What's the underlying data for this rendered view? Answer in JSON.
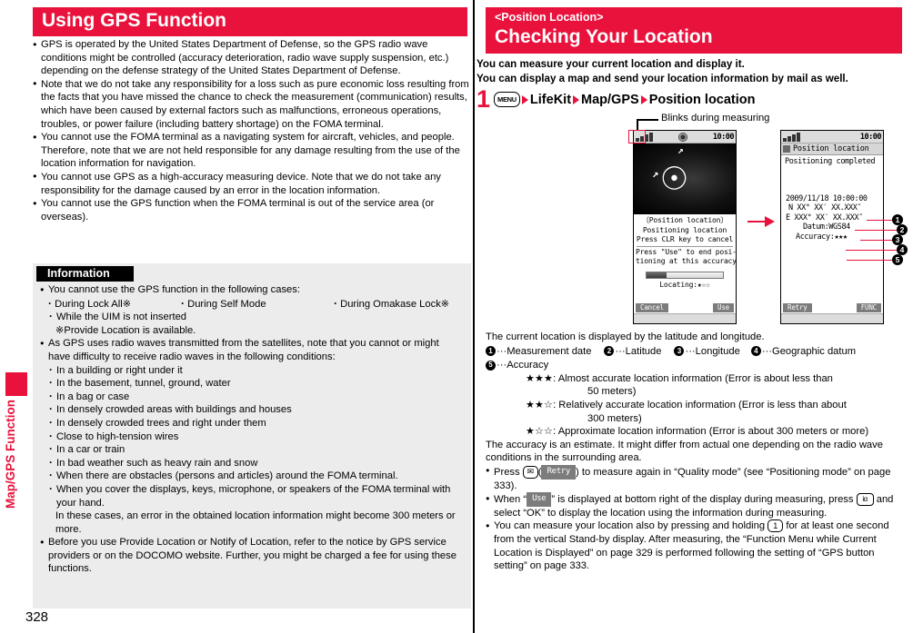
{
  "sidebar": {
    "vertical_label": "Map/GPS Function"
  },
  "page_number": "328",
  "left": {
    "title": "Using GPS Function",
    "bullets": [
      "GPS is operated by the United States Department of Defense, so the GPS radio wave conditions might be controlled (accuracy deterioration, radio wave supply suspension, etc.) depending on the defense strategy of the United States Department of Defense.",
      "Note that we do not take any responsibility for a loss such as pure economic loss resulting from the facts that you have missed the chance to check the measurement (communication) results, which have been caused by external factors such as malfunctions, erroneous operations, troubles, or power failure (including battery shortage) on the FOMA terminal.",
      "You cannot use the FOMA terminal as a navigating system for aircraft, vehicles, and people. Therefore, note that we are not held responsible for any damage resulting from the use of the location information for navigation.",
      "You cannot use GPS as a high-accuracy measuring device. Note that we do not take any responsibility for the damage caused by an error in the location information.",
      "You cannot use the GPS function when the FOMA terminal is out of the service area (or overseas)."
    ],
    "information": {
      "heading": "Information",
      "item1_lead": "You cannot use the GPS function in the following cases:",
      "item1_cases": [
        "During Lock All※",
        "During Self Mode",
        "During Omakase Lock※"
      ],
      "item1_case4": "While the UIM is not inserted",
      "item1_note": "※Provide Location is available.",
      "item2_lead": "As GPS uses radio waves transmitted from the satellites, note that you cannot or might have difficulty to receive radio waves in the following conditions:",
      "item2_conditions": [
        "In a building or right under it",
        "In the basement, tunnel, ground, water",
        "In a bag or case",
        "In densely crowded areas with buildings and houses",
        "In densely crowded trees and right under them",
        "Close to high-tension wires",
        "In a car or train",
        "In bad weather such as heavy rain and snow",
        "When there are obstacles (persons and articles) around the FOMA terminal.",
        "When you cover the displays, keys, microphone, or speakers of the FOMA terminal with your hand."
      ],
      "item2_tail": "In these cases, an error in the obtained location information might become 300 meters or more.",
      "item3": "Before you use Provide Location or Notify of Location, refer to the notice by GPS service providers or on the DOCOMO website. Further, you might be charged a fee for using these functions."
    }
  },
  "right": {
    "header_small": "<Position Location>",
    "header_big": "Checking Your Location",
    "lead_line1": "You can measure your current location and display it.",
    "lead_line2": "You can display a map and send your location information by mail as well.",
    "step": {
      "number": "1",
      "menu_key": "MENU",
      "path": [
        "LifeKit",
        "Map/GPS",
        "Position location"
      ]
    },
    "callout": "Blinks during measuring",
    "phone1": {
      "status_time": "10:00",
      "line1": "〔Position location〕",
      "line2": "Positioning location",
      "line3": "Press CLR key to cancel",
      "line4": "Press \"Use\" to end posi-",
      "line5": "tioning at this accuracy",
      "locating": "Locating:★☆☆",
      "softkey_left": "Cancel",
      "softkey_right": "Use"
    },
    "phone2": {
      "status_time": "10:00",
      "title": "Position location",
      "status_line": "Positioning completed",
      "fields": [
        "2009/11/18 10:00:00",
        "N XX° XX′ XX.XXX″",
        "E XXX° XX′ XX.XXX″",
        "Datum:WGS84",
        "Accuracy:★★★"
      ],
      "softkey_left": "Retry",
      "softkey_right": "FUNC"
    },
    "callout_numbers": [
      "1",
      "2",
      "3",
      "4",
      "5"
    ],
    "explain_intro": "The current location is displayed by the latitude and longitude.",
    "legend": [
      {
        "num": "1",
        "label": "Measurement date"
      },
      {
        "num": "2",
        "label": "Latitude"
      },
      {
        "num": "3",
        "label": "Longitude"
      },
      {
        "num": "4",
        "label": "Geographic datum"
      },
      {
        "num": "5",
        "label": "Accuracy"
      }
    ],
    "accuracy_levels": [
      {
        "stars": "★★★",
        "line1": ": Almost accurate location information (Error is about less than",
        "line2": "50 meters)"
      },
      {
        "stars": "★★☆",
        "line1": ": Relatively accurate location information (Error is less than about",
        "line2": "300 meters)"
      },
      {
        "stars": "★☆☆",
        "line1": ": Approximate location information (Error is about 300 meters or more)",
        "line2": ""
      }
    ],
    "accuracy_note": "The accuracy is an estimate. It might differ from actual one depending on the radio wave conditions in the surrounding area.",
    "notes": {
      "note1_a": "Press",
      "note1_mail_key": "✉",
      "note1_b": "(",
      "note1_soft": "Retry",
      "note1_c": ") to measure again in “Quality mode” (see “Positioning mode” on page 333).",
      "note2_a": "When “",
      "note2_soft": "Use",
      "note2_b": "” is displayed at bottom right of the display during measuring,",
      "note2_c": "press",
      "note2_key": "iα",
      "note2_d": "and select “OK” to display the location using the information during measuring.",
      "note3_a": "You can measure your location also by pressing and holding",
      "note3_key": "1",
      "note3_b": "for at least one second from the vertical Stand-by display. After measuring, the “Function Menu while Current Location is Displayed” on page 329 is performed following the setting of “GPS button setting” on page 333."
    }
  },
  "colors": {
    "accent_red": "#e8123c",
    "info_bg": "#ececec",
    "black": "#000000"
  }
}
